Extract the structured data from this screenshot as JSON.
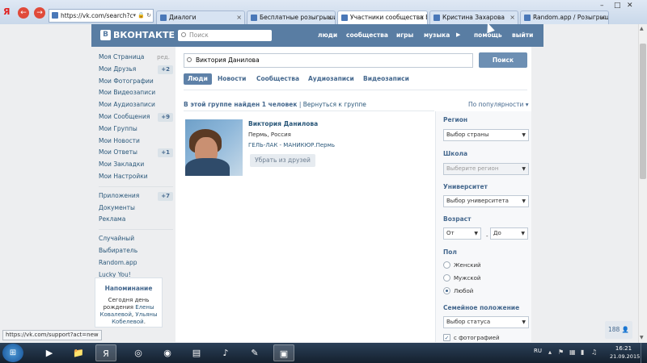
{
  "browser": {
    "url": "https://vk.com/search?c",
    "tabs": [
      {
        "label": "Диалоги",
        "active": false
      },
      {
        "label": "Бесплатные розыгрыши пр...",
        "active": false
      },
      {
        "label": "Участники сообщества Б...",
        "active": true
      },
      {
        "label": "Кристина Захарова",
        "active": false
      },
      {
        "label": "Random.app / Розыгрыши ...",
        "active": false
      }
    ],
    "yandex": "Я",
    "status_url": "https://vk.com/support?act=new"
  },
  "header": {
    "logo": "ВКОНТАКТЕ",
    "logo_letter": "В",
    "search_placeholder": "Поиск",
    "links": [
      "люди",
      "сообщества",
      "игры",
      "музыка",
      "помощь",
      "выйти"
    ]
  },
  "sidebar": {
    "items": [
      {
        "label": "Моя Страница",
        "extra": "ред."
      },
      {
        "label": "Мои Друзья",
        "count": "+2"
      },
      {
        "label": "Мои Фотографии"
      },
      {
        "label": "Мои Видеозаписи"
      },
      {
        "label": "Мои Аудиозаписи"
      },
      {
        "label": "Мои Сообщения",
        "count": "+9"
      },
      {
        "label": "Мои Группы"
      },
      {
        "label": "Мои Новости"
      },
      {
        "label": "Мои Ответы",
        "count": "+1"
      },
      {
        "label": "Мои Закладки"
      },
      {
        "label": "Мои Настройки"
      }
    ],
    "items2": [
      {
        "label": "Приложения",
        "count": "+7"
      },
      {
        "label": "Документы"
      },
      {
        "label": "Реклама"
      }
    ],
    "items3": [
      {
        "label": "Случайный"
      },
      {
        "label": "Выбиратель"
      },
      {
        "label": "Random.app"
      },
      {
        "label": "Lucky You!"
      }
    ],
    "reminder": {
      "title": "Напоминание",
      "line1": "Сегодня ",
      "line1b": "день",
      "line2": "рождения ",
      "name1": "Елены",
      "name2": "Ковалевой",
      "comma": ", ",
      "name3": "Ульяны",
      "name4": "Кобелевой",
      "end": "."
    }
  },
  "search": {
    "query": "Виктория Данилова",
    "button": "Поиск",
    "tabs": [
      "Люди",
      "Новости",
      "Сообщества",
      "Аудиозаписи",
      "Видеозаписи"
    ],
    "result_info": "В этой группе найден 1 человек",
    "result_back": "Вернуться к группе",
    "sort": "По популярности"
  },
  "result": {
    "name": "Виктория Данилова",
    "city": "Пермь, Россия",
    "status": "ГЕЛЬ-ЛАК - МАНИКЮР.Пермь",
    "button": "Убрать из друзей"
  },
  "filters": {
    "region_label": "Регион",
    "region_value": "Выбор страны",
    "school_label": "Школа",
    "school_value": "Выберите регион",
    "university_label": "Университет",
    "university_value": "Выбор университета",
    "age_label": "Возраст",
    "age_from": "От",
    "age_to": "До",
    "gender_label": "Пол",
    "gender_options": [
      "Женский",
      "Мужской",
      "Любой"
    ],
    "gender_selected": 2,
    "marital_label": "Семейное положение",
    "marital_value": "Выбор статуса",
    "photo_label": "с фотографией"
  },
  "online_count": "188",
  "taskbar": {
    "lang": "RU",
    "time": "16:21",
    "date": "21.09.2015"
  }
}
